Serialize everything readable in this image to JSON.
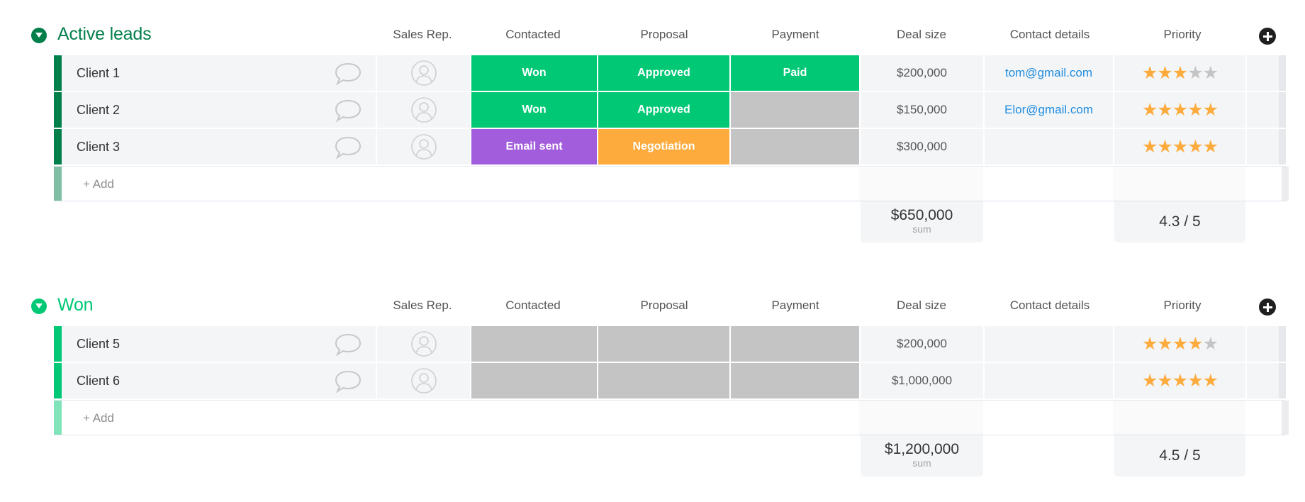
{
  "columns": {
    "sales_rep": "Sales Rep.",
    "contacted": "Contacted",
    "proposal": "Proposal",
    "payment": "Payment",
    "deal_size": "Deal size",
    "contact_details": "Contact details",
    "priority": "Priority"
  },
  "colors": {
    "active_leads_group": "#037f4c",
    "active_leads_add_bar": "#81bfa5",
    "won_group": "#00c875",
    "won_add_bar": "#80e3ba",
    "status_won": "#00c875",
    "status_approved": "#00c875",
    "status_paid": "#00c875",
    "status_email_sent": "#a25ddc",
    "status_negotiation": "#fdab3d",
    "status_empty": "#c4c4c4",
    "star_filled": "#fdab3d",
    "star_empty": "#c4c4c4",
    "email_link": "#1f8de0"
  },
  "groups": [
    {
      "title": "Active leads",
      "add_label": "+ Add",
      "rows": [
        {
          "name": "Client 1",
          "contacted": "Won",
          "proposal": "Approved",
          "payment": "Paid",
          "deal_size": "$200,000",
          "contact": "tom@gmail.com",
          "priority": 3
        },
        {
          "name": "Client 2",
          "contacted": "Won",
          "proposal": "Approved",
          "payment": "",
          "deal_size": "$150,000",
          "contact": "Elor@gmail.com",
          "priority": 5
        },
        {
          "name": "Client 3",
          "contacted": "Email sent",
          "proposal": "Negotiation",
          "payment": "",
          "deal_size": "$300,000",
          "contact": "",
          "priority": 5
        }
      ],
      "summary": {
        "deal_size": "$650,000",
        "deal_size_label": "sum",
        "priority": "4.3 / 5"
      }
    },
    {
      "title": "Won",
      "add_label": "+ Add",
      "rows": [
        {
          "name": "Client 5",
          "contacted": "",
          "proposal": "",
          "payment": "",
          "deal_size": "$200,000",
          "contact": "",
          "priority": 4
        },
        {
          "name": "Client 6",
          "contacted": "",
          "proposal": "",
          "payment": "",
          "deal_size": "$1,000,000",
          "contact": "",
          "priority": 5
        }
      ],
      "summary": {
        "deal_size": "$1,200,000",
        "deal_size_label": "sum",
        "priority": "4.5 / 5"
      }
    }
  ],
  "priority_max": 5,
  "icons": {
    "collapse": "chevron-down-circle-icon",
    "add_column": "plus-circle-icon",
    "updates": "chat-bubble-icon",
    "person": "person-circle-icon",
    "star": "star-icon"
  }
}
